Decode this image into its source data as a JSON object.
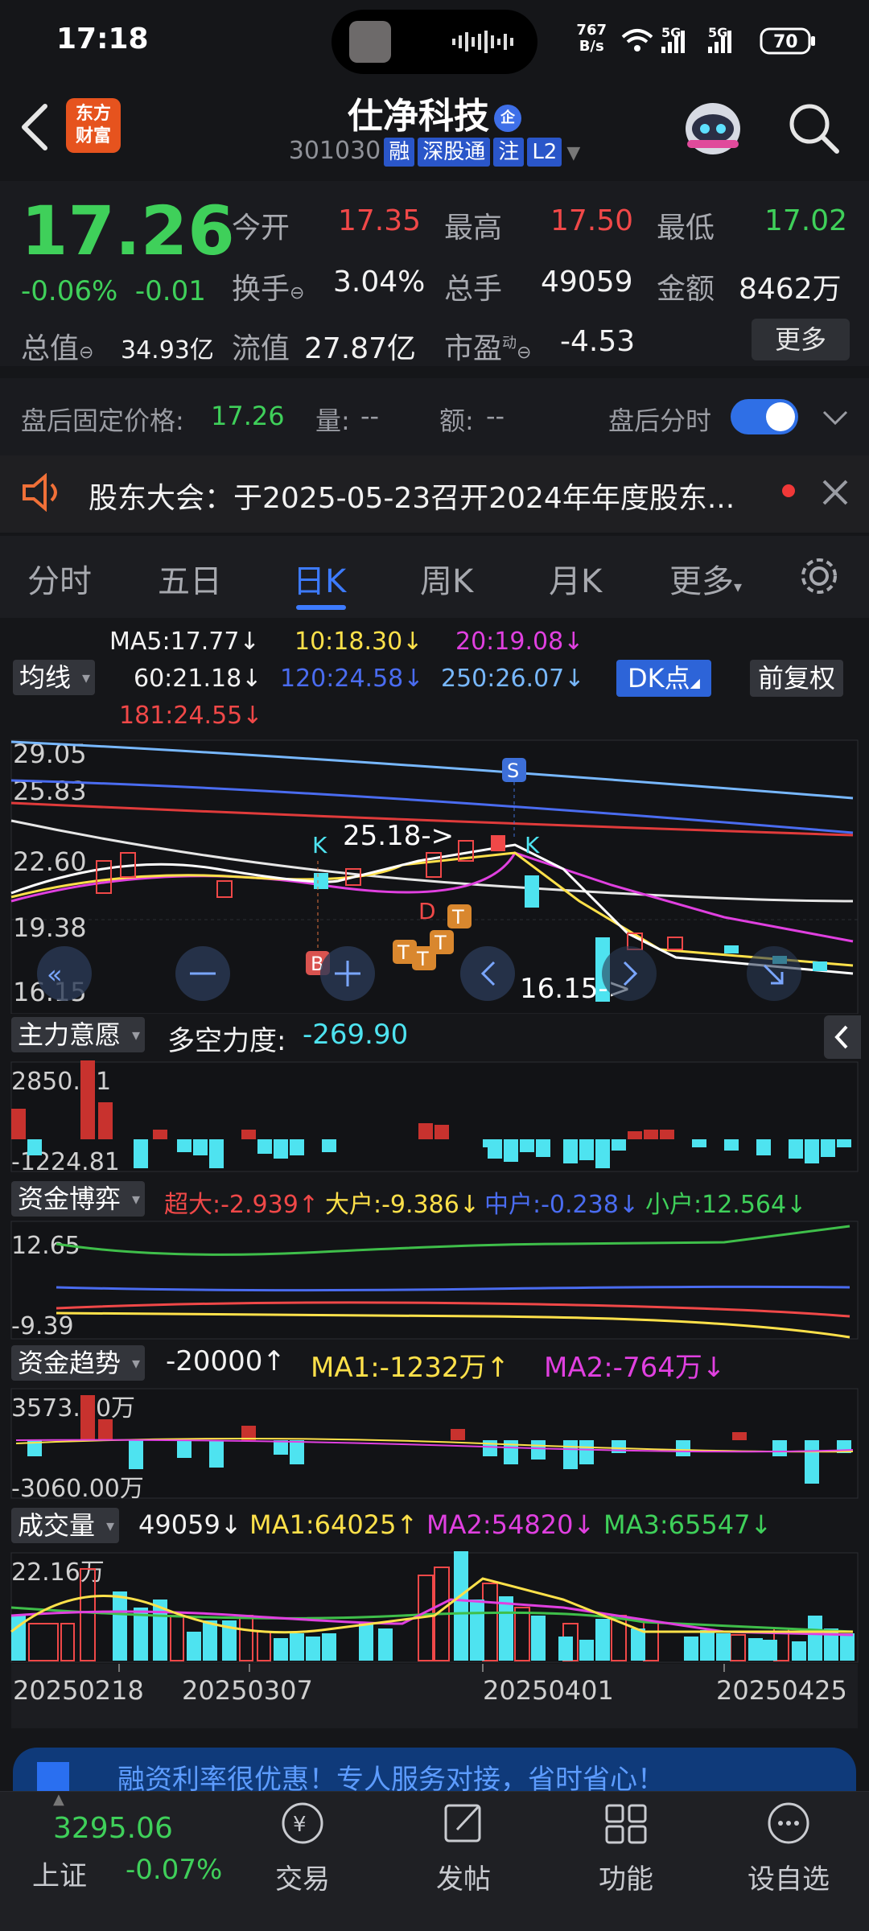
{
  "status": {
    "time": "17:18",
    "net_speed_top": "767",
    "net_speed_bottom": "B/s",
    "sig1": "5G",
    "sig2": "5G",
    "battery": "70"
  },
  "header": {
    "logo_line1": "东方",
    "logo_line2": "财富",
    "name": "仕净科技",
    "name_badge": "企",
    "code": "301030",
    "tags": [
      "融",
      "深股通",
      "注",
      "L2"
    ]
  },
  "quote": {
    "price": "17.26",
    "chg_pct": "-0.06%",
    "chg_abs": "-0.01",
    "open_label": "今开",
    "open": "17.35",
    "high_label": "最高",
    "high": "17.50",
    "low_label": "最低",
    "low": "17.02",
    "turnover_label": "换手",
    "turnover": "3.04%",
    "volume_label": "总手",
    "volume": "49059",
    "amount_label": "金额",
    "amount": "8462万",
    "mktcap_label": "总值",
    "mktcap": "34.93亿",
    "float_label": "流值",
    "float": "27.87亿",
    "pe_label": "市盈",
    "pe_sup": "动",
    "pe": "-4.53",
    "more": "更多"
  },
  "afterhours": {
    "price_label": "盘后固定价格:",
    "price": "17.26",
    "vol_label": "量:",
    "vol": "--",
    "amt_label": "额:",
    "amt": "--",
    "toggle_label": "盘后分时",
    "toggle_on": true
  },
  "notice": {
    "text": "股东大会：于2025-05-23召开2024年年度股东..."
  },
  "tabs": [
    "分时",
    "五日",
    "日K",
    "周K",
    "月K",
    "更多"
  ],
  "active_tab": "日K",
  "kline": {
    "ma_button": "均线",
    "ma5": "MA5:17.77↓",
    "ma10": "10:18.30↓",
    "ma20": "20:19.08↓",
    "ma60": "60:21.18↓",
    "ma120": "120:24.58↓",
    "ma250": "250:26.07↓",
    "ma181": "181:24.55↓",
    "dk_button": "DK点",
    "adjust_button": "前复权",
    "y_labels": [
      "29.05",
      "25.83",
      "22.60",
      "19.38",
      "16.15"
    ],
    "high_note": "25.18->",
    "low_note": "16.15->",
    "markers": {
      "s": "S",
      "b": "B",
      "k": "K",
      "t": "T",
      "d": "D"
    }
  },
  "zlyy": {
    "button": "主力意愿",
    "label": "多空力度:",
    "value": "-269.90",
    "ymax": "2850.71",
    "ymin": "-1224.81"
  },
  "zjby": {
    "button": "资金博弈",
    "super": "超大:-2.939↑",
    "big": "大户:-9.386↓",
    "mid": "中户:-0.238↓",
    "small": "小户:12.564↓",
    "ymax": "12.65",
    "ymin": "-9.39"
  },
  "zjqs": {
    "button": "资金趋势",
    "v": "-20000↑",
    "ma1": "MA1:-1232万↑",
    "ma2": "MA2:-764万↓",
    "ymax": "3573.00万",
    "ymin": "-3060.00万"
  },
  "vol": {
    "button": "成交量",
    "v": "49059↓",
    "ma1": "MA1:64025↑",
    "ma2": "MA2:54820↓",
    "ma3": "MA3:65547↓",
    "ymax": "22.16万",
    "dates": [
      "20250218",
      "20250307",
      "20250401",
      "20250425"
    ]
  },
  "ad": {
    "text": "融资利率很优惠！专人服务对接，省时省心！"
  },
  "index": {
    "value": "3295.06",
    "name": "上证",
    "chg": "-0.07%"
  },
  "nav": [
    {
      "label": "交易",
      "icon": "trade-icon"
    },
    {
      "label": "发帖",
      "icon": "post-icon"
    },
    {
      "label": "功能",
      "icon": "apps-icon"
    },
    {
      "label": "设自选",
      "icon": "add-watchlist-icon"
    }
  ],
  "colors": {
    "up": "#f04848",
    "down": "#4ee3f0",
    "green": "#3fd05a",
    "accent": "#2f6fe6"
  }
}
